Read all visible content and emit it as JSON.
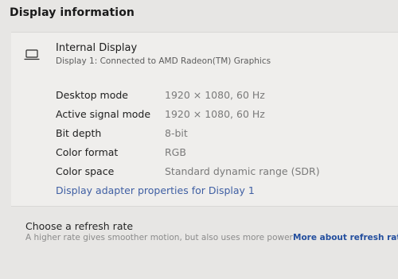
{
  "section": {
    "title": "Display information"
  },
  "display": {
    "icon": "laptop-icon",
    "name": "Internal Display",
    "subtitle": "Display 1: Connected to AMD Radeon(TM) Graphics"
  },
  "info": [
    {
      "label": "Desktop mode",
      "value": "1920 × 1080, 60 Hz"
    },
    {
      "label": "Active signal mode",
      "value": "1920 × 1080, 60 Hz"
    },
    {
      "label": "Bit depth",
      "value": "8-bit"
    },
    {
      "label": "Color format",
      "value": "RGB"
    },
    {
      "label": "Color space",
      "value": "Standard dynamic range (SDR)"
    }
  ],
  "adapter_link": "Display adapter properties for Display 1",
  "refresh": {
    "title": "Choose a refresh rate",
    "description": "A higher rate gives smoother motion, but also uses more power",
    "link": "More about refresh rate"
  },
  "colors": {
    "link": "#3f5fa3",
    "accent_link": "#244f9e",
    "background": "#e7e6e4",
    "card": "#efeeec"
  }
}
